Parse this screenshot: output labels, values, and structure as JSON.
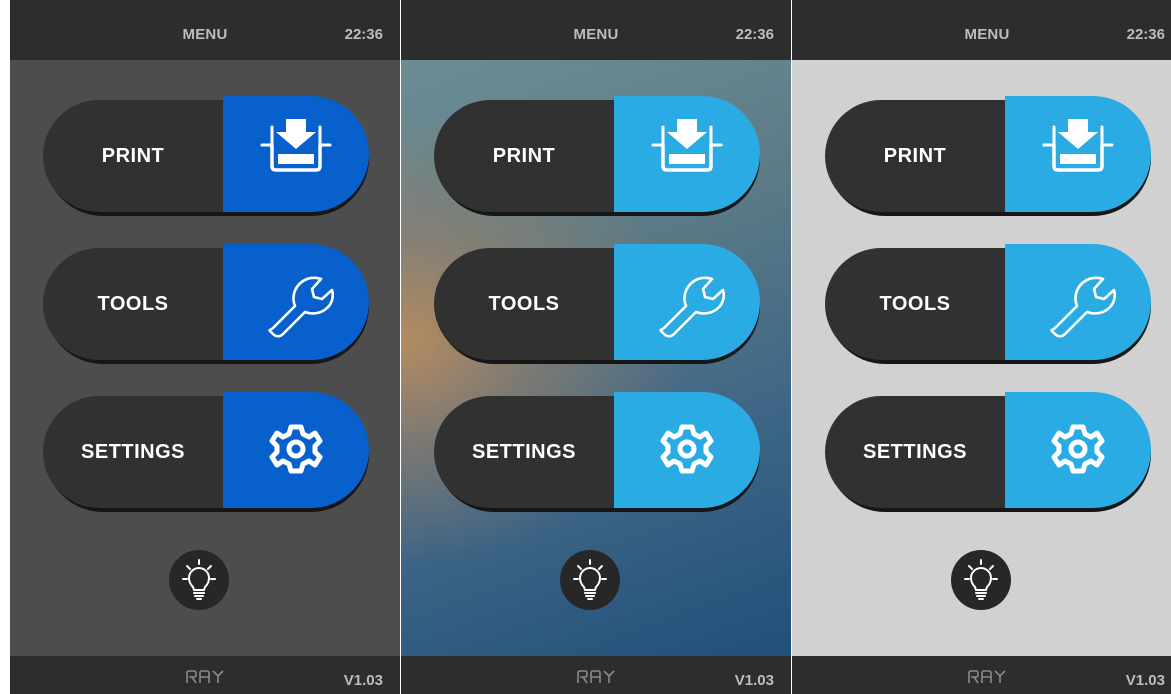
{
  "theme_colors": {
    "accent_dark": "#0860cc",
    "accent_light": "#2aabe3",
    "button_body": "#313131",
    "bar": "#2d2d2d",
    "bar_text": "#bdbdbd"
  },
  "panels": [
    {
      "variant": "dark",
      "header": {
        "title": "MENU",
        "time": "22:36"
      },
      "menu": [
        {
          "label": "PRINT",
          "icon": "print-download-icon"
        },
        {
          "label": "TOOLS",
          "icon": "wrench-icon"
        },
        {
          "label": "SETTINGS",
          "icon": "gear-icon"
        }
      ],
      "light_button": {
        "icon": "lightbulb-icon"
      },
      "footer": {
        "logo": "RAY",
        "version": "V1.03"
      }
    },
    {
      "variant": "gradient",
      "header": {
        "title": "MENU",
        "time": "22:36"
      },
      "menu": [
        {
          "label": "PRINT",
          "icon": "print-download-icon"
        },
        {
          "label": "TOOLS",
          "icon": "wrench-icon"
        },
        {
          "label": "SETTINGS",
          "icon": "gear-icon"
        }
      ],
      "light_button": {
        "icon": "lightbulb-icon"
      },
      "footer": {
        "logo": "RAY",
        "version": "V1.03"
      }
    },
    {
      "variant": "light",
      "header": {
        "title": "MENU",
        "time": "22:36"
      },
      "menu": [
        {
          "label": "PRINT",
          "icon": "print-download-icon"
        },
        {
          "label": "TOOLS",
          "icon": "wrench-icon"
        },
        {
          "label": "SETTINGS",
          "icon": "gear-icon"
        }
      ],
      "light_button": {
        "icon": "lightbulb-icon"
      },
      "footer": {
        "logo": "RAY",
        "version": "V1.03"
      }
    }
  ]
}
